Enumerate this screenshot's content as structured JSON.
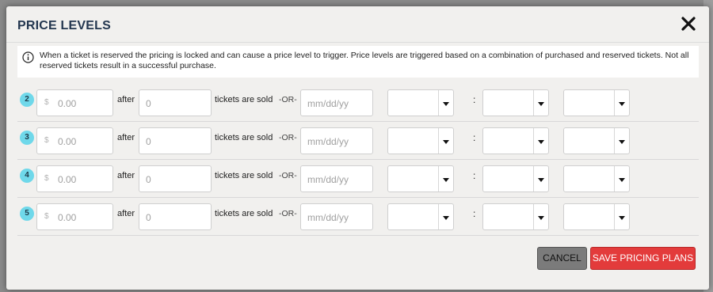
{
  "modal": {
    "title": "PRICE LEVELS",
    "close_icon": "close-x-icon"
  },
  "info": {
    "icon": "info-circle-icon",
    "text": "When a ticket is reserved the pricing is locked and can cause a price level to trigger. Price levels are triggered based on a combination of purchased and reserved tickets. Not all reserved tickets result in a successful purchase."
  },
  "labels": {
    "after": "after",
    "tickets_are_sold": "tickets are sold",
    "or": "-OR-",
    "colon": ":",
    "currency": "$"
  },
  "levels": [
    {
      "number": "2",
      "price_placeholder": "0.00",
      "qty_placeholder": "0",
      "date_placeholder": "mm/dd/yy"
    },
    {
      "number": "3",
      "price_placeholder": "0.00",
      "qty_placeholder": "0",
      "date_placeholder": "mm/dd/yy"
    },
    {
      "number": "4",
      "price_placeholder": "0.00",
      "qty_placeholder": "0",
      "date_placeholder": "mm/dd/yy"
    },
    {
      "number": "5",
      "price_placeholder": "0.00",
      "qty_placeholder": "0",
      "date_placeholder": "mm/dd/yy"
    }
  ],
  "footer": {
    "cancel_label": "CANCEL",
    "save_label": "SAVE PRICING PLANS"
  },
  "colors": {
    "title": "#23364f",
    "badge": "#6fd8ea",
    "save_button": "#e33b3b",
    "cancel_button": "#7b7b7b"
  }
}
